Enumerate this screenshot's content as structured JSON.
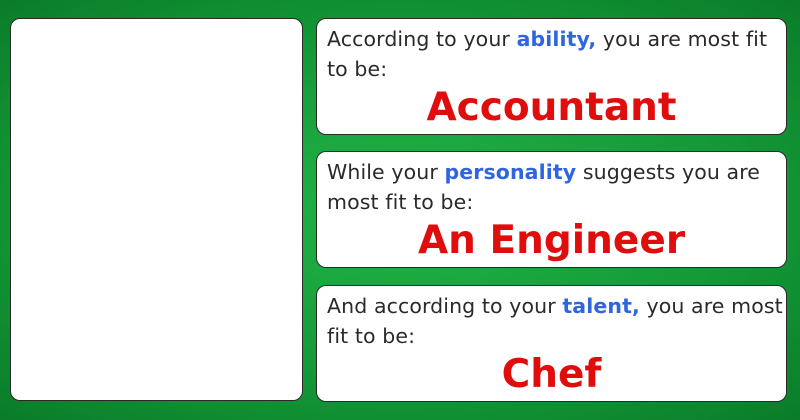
{
  "cards": [
    {
      "prefix": "According to your ",
      "keyword": "ability,",
      "suffix": " you are most fit to be:",
      "result": "Accountant"
    },
    {
      "prefix": "While your ",
      "keyword": "personality",
      "suffix": " suggests you are most fit to be:",
      "result": "An Engineer"
    },
    {
      "prefix": "And according to your ",
      "keyword": "talent,",
      "suffix": " you are most fit to be:",
      "result": "Chef"
    }
  ],
  "colors": {
    "background": "#149a38",
    "keyword": "#2f66e0",
    "result": "#e00d0d",
    "text": "#2a2a2a"
  }
}
